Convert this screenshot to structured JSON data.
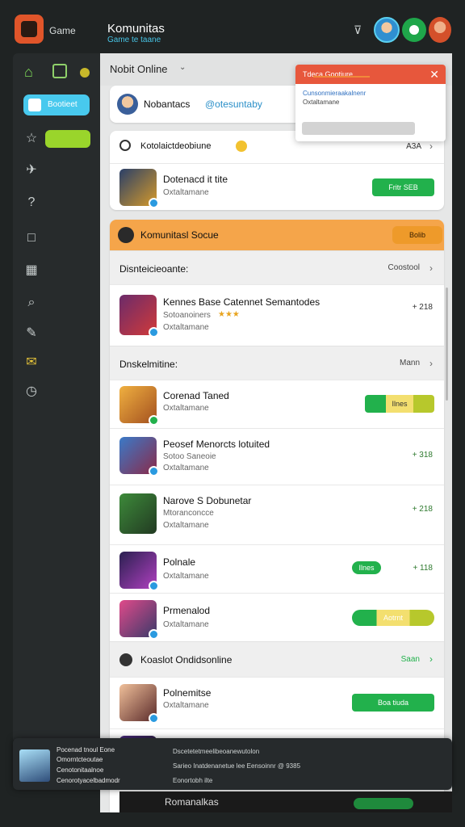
{
  "topbar": {
    "logo_text": "Game",
    "title": "Komunitas",
    "subtitle": "Game te taane"
  },
  "sidebar": {
    "active_label": "Bootieet",
    "items": [
      "home-icon",
      "grid-icon",
      "dot-icon",
      "star-icon",
      "plane-icon",
      "help-icon",
      "square-icon",
      "puzzle-icon",
      "search-icon",
      "wrench-icon",
      "mail-icon",
      "clock-icon"
    ]
  },
  "main": {
    "header_title": "Nobit Online",
    "header_caret": "⌄",
    "profile": {
      "name": "Nobantacs",
      "handle": "@otesuntaby"
    },
    "list1": {
      "title": "Kotolaictdeobiune",
      "meta": "A3A",
      "items": [
        {
          "title": "Dotenacd it tite",
          "sub": "Oxtaltamane",
          "button": "Fritr   SEB"
        }
      ]
    },
    "community": {
      "title": "Komunitasl Socue",
      "button": "Bolib",
      "section_a_title": "Disnteicieoante:",
      "section_a_right": "Coostool",
      "featured": {
        "title": "Kennes Base Catennet Semantodes",
        "sub": "Sotoanoiners",
        "sub2": "Oxtaltamane",
        "meta": "+ 218"
      },
      "section_b_title": "Dnskelmitine:",
      "section_b_right": "Mann",
      "items": [
        {
          "title": "Corenad Taned",
          "sub": "Oxtaltamane",
          "sub2": "",
          "meta": "",
          "button": "Ilnes"
        },
        {
          "title": "Peosef Menorcts lotuited",
          "sub": "Sotoo Saneoie",
          "sub2": "Oxtaltamane",
          "meta": "+ 318",
          "button": ""
        },
        {
          "title": "Narove S Dobunetar",
          "sub": "Mtoranconcce",
          "sub2": "Oxtaltamane",
          "meta": "+ 218",
          "button": ""
        },
        {
          "title": "Polnale",
          "sub": "Oxtaltamane",
          "sub2": "",
          "meta": "+ 118",
          "button": "Ilnes"
        },
        {
          "title": "Prmenalod",
          "sub": "Oxtaltamane",
          "sub2": "",
          "meta": "",
          "button": "Aotrnt"
        }
      ],
      "section_c_title": "Koaslot Ondidsonline",
      "section_c_right": "Saan",
      "item_c": {
        "title": "Polnemitse",
        "sub": "Oxtaltamane",
        "button": "Boa tiuda"
      },
      "item_d": {
        "title": "Romanalkas",
        "button": ""
      }
    }
  },
  "popup": {
    "title": "Tdeca Gootiure",
    "close": "✕",
    "link": "Cunsonmieraakalnenr",
    "sub": "Oxtaltamane",
    "progress": 0.5
  },
  "notify": {
    "line1": "Pocenad tnoul Eone",
    "line2": "Omorntcteoutae",
    "line3": "Cenotonitaalnoe",
    "line4": "Cenorotyacelbadmodr",
    "right1": "Dscetetetmeelibeoanewutolon",
    "right2": "Sarieo Inatdenanetue lee  Eensoinnr @ 9385",
    "right3": "Eonortobh ilte"
  },
  "colors": {
    "accent_cyan": "#48c9ee",
    "green": "#22b14c",
    "orange": "#f0a335",
    "popup_red": "#e7573c"
  }
}
